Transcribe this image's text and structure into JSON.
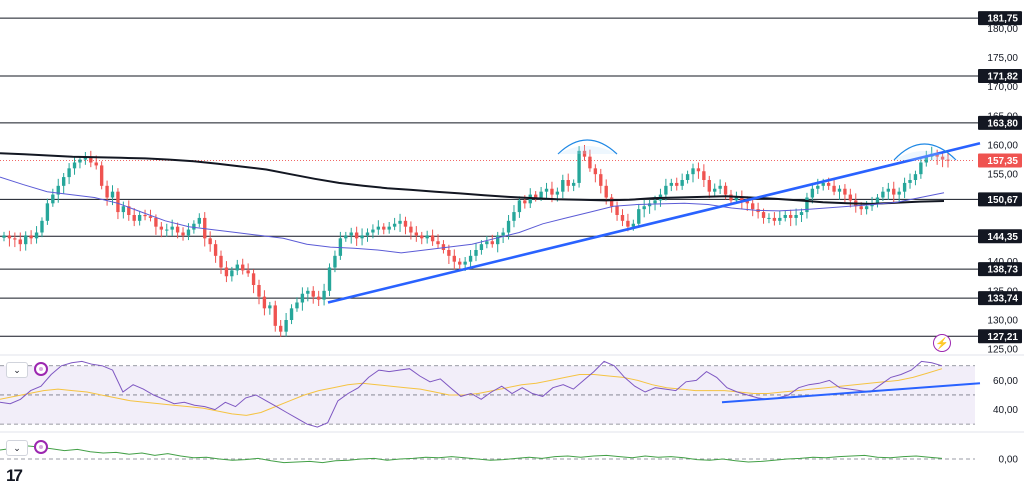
{
  "chart_data": [
    {
      "type": "candlestick",
      "ylim": [
        124,
        184
      ],
      "y_ticks": [
        "125,00",
        "130,00",
        "135,00",
        "140,00",
        "155,00",
        "160,00",
        "165,00",
        "170,00",
        "175,00",
        "180,00"
      ],
      "y_tick_values": [
        125,
        130,
        135,
        140,
        155,
        160,
        165,
        170,
        175,
        180
      ],
      "last_price": "157,35",
      "last_price_value": 157.35,
      "levels": [
        {
          "label": "181,75",
          "value": 181.75
        },
        {
          "label": "171,82",
          "value": 171.82
        },
        {
          "label": "163,80",
          "value": 163.8
        },
        {
          "label": "150,67",
          "value": 150.67
        },
        {
          "label": "144,35",
          "value": 144.35
        },
        {
          "label": "138,73",
          "value": 138.73
        },
        {
          "label": "133,74",
          "value": 133.74
        },
        {
          "label": "127,21",
          "value": 127.21
        }
      ],
      "closes": [
        144.5,
        144.0,
        143.8,
        143.0,
        144.5,
        144.0,
        145.0,
        147.0,
        150.0,
        151.5,
        153.0,
        154.5,
        156.0,
        157.0,
        157.5,
        158.0,
        157.0,
        156.5,
        153.0,
        151.0,
        152.0,
        148.5,
        149.5,
        148.0,
        147.0,
        148.0,
        147.8,
        147.5,
        146.0,
        145.5,
        145.5,
        146.0,
        145.0,
        144.5,
        145.5,
        146.5,
        147.5,
        144.0,
        143.0,
        141.0,
        139.0,
        137.5,
        138.5,
        139.5,
        138.5,
        138.0,
        136.0,
        134.0,
        132.0,
        132.5,
        129.0,
        128.0,
        130.0,
        132.0,
        133.0,
        134.5,
        135.0,
        134.0,
        133.5,
        135.0,
        139.0,
        141.0,
        144.0,
        144.5,
        145.0,
        144.0,
        144.5,
        145.0,
        145.5,
        146.0,
        145.5,
        146.0,
        146.5,
        147.0,
        146.0,
        145.0,
        144.5,
        144.0,
        144.5,
        143.5,
        143.0,
        142.0,
        141.0,
        140.0,
        139.5,
        140.0,
        141.0,
        142.0,
        143.0,
        143.5,
        143.0,
        144.5,
        145.0,
        147.0,
        148.5,
        150.5,
        150.0,
        151.5,
        151.0,
        152.0,
        152.5,
        151.5,
        152.0,
        154.0,
        153.0,
        153.5,
        159.0,
        158.0,
        156.0,
        155.0,
        153.0,
        151.0,
        149.5,
        148.0,
        147.0,
        146.0,
        146.5,
        149.0,
        149.5,
        150.0,
        150.5,
        151.5,
        153.0,
        153.5,
        153.0,
        154.0,
        155.0,
        156.0,
        155.5,
        154.0,
        152.0,
        152.5,
        153.0,
        151.5,
        150.5,
        151.0,
        150.5,
        150.0,
        149.0,
        148.5,
        147.5,
        147.5,
        147.0,
        147.5,
        148.0,
        147.5,
        148.0,
        148.5,
        151.0,
        152.5,
        153.0,
        153.5,
        153.0,
        152.0,
        152.5,
        151.5,
        150.5,
        149.5,
        149.0,
        149.5,
        150.0,
        151.0,
        152.0,
        152.5,
        151.5,
        152.0,
        153.5,
        154.0,
        155.0,
        157.0,
        158.0,
        158.5,
        158.0,
        157.5,
        157.35
      ],
      "sma_black": [
        158.6,
        158.4,
        158.2,
        158.0,
        157.9,
        157.8,
        157.7,
        157.5,
        157.2,
        156.8,
        156.3,
        155.8,
        155.0,
        154.2,
        153.5,
        153.0,
        152.6,
        152.3,
        152.0,
        151.7,
        151.4,
        151.1,
        150.9,
        150.7,
        150.6,
        150.5,
        150.6,
        150.9,
        151.0,
        151.1,
        151.2,
        151.0,
        150.8,
        150.5,
        150.2,
        150.0,
        149.9,
        150.1,
        150.3,
        150.4
      ],
      "sma_blue": [
        154.5,
        153.2,
        152.0,
        151.5,
        151.0,
        150.0,
        148.5,
        147.0,
        146.0,
        145.5,
        145.0,
        144.5,
        144.0,
        143.0,
        142.5,
        142.3,
        142.0,
        141.5,
        142.0,
        142.5,
        143.0,
        144.0,
        145.0,
        146.5,
        147.5,
        148.5,
        149.5,
        149.8,
        149.9,
        150.0,
        149.8,
        149.2,
        148.8,
        148.7,
        148.9,
        149.2,
        149.5,
        149.8,
        150.2,
        151.0,
        151.8
      ],
      "rsi": {
        "y_ticks": [
          "60,00",
          "40,00"
        ],
        "y_tick_values": [
          60,
          40
        ],
        "ylim": [
          26,
          76
        ],
        "upper_band": 70,
        "lower_band": 30,
        "midline": 50,
        "rsi_values": [
          45,
          44,
          47,
          53,
          56,
          64,
          70,
          72,
          73,
          71,
          70,
          67,
          52,
          57,
          54,
          50,
          47,
          44,
          45,
          43,
          42,
          40,
          45,
          42,
          48,
          50,
          46,
          42,
          38,
          34,
          30,
          28,
          31,
          46,
          51,
          55,
          62,
          67,
          66,
          67,
          68,
          63,
          59,
          61,
          55,
          49,
          51,
          47,
          52,
          56,
          51,
          55,
          51,
          49,
          55,
          57,
          54,
          60,
          66,
          73,
          70,
          62,
          56,
          52,
          55,
          54,
          53,
          59,
          60,
          66,
          62,
          55,
          52,
          50,
          48,
          47,
          48,
          50,
          55,
          57,
          58,
          60,
          55,
          54,
          53,
          52,
          57,
          62,
          64,
          67,
          73,
          72,
          70
        ],
        "ma_values": [
          47,
          49,
          51,
          53,
          54,
          53,
          52,
          50,
          48,
          46,
          45,
          44,
          43,
          42,
          41,
          39,
          37,
          36,
          38,
          42,
          46,
          50,
          53,
          55,
          57,
          58,
          57,
          56,
          55,
          54,
          52,
          50,
          50,
          51,
          53,
          55,
          57,
          58,
          60,
          62,
          64,
          64,
          63,
          62,
          60,
          57,
          55,
          54,
          53,
          53,
          53,
          52,
          51,
          51,
          52,
          53,
          54,
          55,
          56,
          57,
          58,
          59,
          60,
          62,
          65,
          68
        ]
      },
      "macd": {
        "y_ticks": [
          "0,00"
        ],
        "y_tick_values": [
          0
        ],
        "values": [
          1.5,
          1.8,
          2.2,
          2.0,
          1.7,
          1.4,
          1.6,
          1.2,
          1.0,
          1.1,
          0.8,
          1.0,
          0.6,
          0.9,
          0.5,
          0.2,
          0.3,
          0.0,
          -0.2,
          -0.1,
          0.1,
          -0.3,
          -0.6,
          -0.5,
          -0.4,
          -0.6,
          -0.3,
          -0.2,
          0.0,
          0.1,
          -0.2,
          0.0,
          0.1,
          0.3,
          0.2,
          0.4,
          0.2,
          0.0,
          -0.2,
          -0.1,
          0.1,
          0.3,
          0.1,
          0.4,
          0.5,
          0.3,
          0.5,
          0.6,
          0.4,
          0.2,
          0.5,
          0.3,
          0.4,
          0.2,
          -0.1,
          -0.2,
          0.0,
          -0.3,
          -0.5,
          -0.4,
          -0.2,
          0.0,
          0.1,
          0.3,
          0.2,
          0.4,
          0.5,
          0.6,
          0.3,
          0.2,
          0.4,
          0.5,
          0.3,
          0.1
        ]
      }
    }
  ],
  "colors": {
    "up": "#26a69a",
    "down": "#ef5350",
    "sma_black": "#131722",
    "sma_blue": "#5b5bd6",
    "trendline": "#2962ff",
    "rsi_line": "#7e57c2",
    "rsi_ma": "#f5c342",
    "rsi_band_fill": "#ede7f6",
    "macd_line": "#43a047",
    "last_price_tag": "#ef5350",
    "level_line": "#131722",
    "arc": "#1e88e5"
  },
  "icons": {
    "pane_collapse": "chevron-down-icon",
    "indicator_settings": "circle-icon",
    "alert": "lightning-icon",
    "logo": "tradingview-logo"
  },
  "ui": {
    "logo_text": "17",
    "rsi_chevron": "⌄",
    "macd_chevron": "⌄",
    "bolt_glyph": "⚡"
  }
}
